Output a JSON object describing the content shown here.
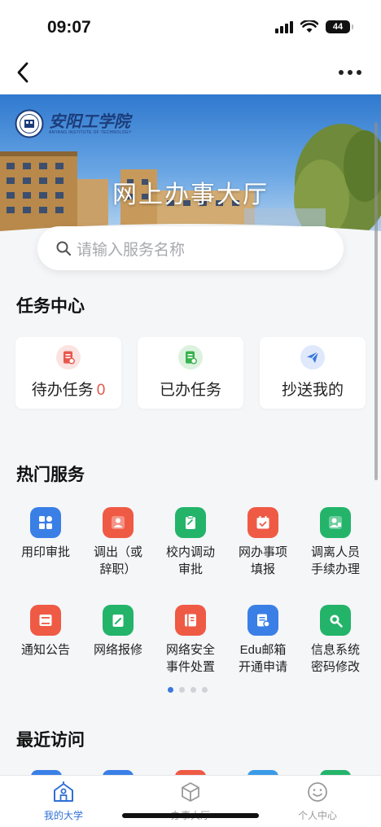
{
  "status_bar": {
    "time": "09:07",
    "battery": "44"
  },
  "banner": {
    "title": "网上办事大厅",
    "logo_cn": "安阳工学院",
    "logo_en": "ANYANG INSTITUTE OF TECHNOLOGY"
  },
  "search": {
    "placeholder": "请输入服务名称"
  },
  "task_center": {
    "title": "任务中心",
    "cards": [
      {
        "label": "待办任务",
        "count": "0",
        "icon": "doc-icon",
        "color": "#e8584f"
      },
      {
        "label": "已办任务",
        "icon": "doc-check-icon",
        "color": "#37b24d"
      },
      {
        "label": "抄送我的",
        "icon": "paper-plane-icon",
        "color": "#3b78dd"
      }
    ]
  },
  "hot_services": {
    "title": "热门服务",
    "items": [
      {
        "label": "用印审批",
        "icon": "grid-icon",
        "color": "#3a7fe6"
      },
      {
        "label": "调出（或\n辞职）",
        "icon": "person-icon",
        "color": "#ef5a45"
      },
      {
        "label": "校内调动\n审批",
        "icon": "clipboard-icon",
        "color": "#23b46a"
      },
      {
        "label": "网办事项\n填报",
        "icon": "calendar-icon",
        "color": "#ef5a45"
      },
      {
        "label": "调离人员\n手续办理",
        "icon": "person-badge-icon",
        "color": "#23b46a"
      },
      {
        "label": "通知公告",
        "icon": "notice-icon",
        "color": "#ef5a45"
      },
      {
        "label": "网络报修",
        "icon": "edit-icon",
        "color": "#23b46a"
      },
      {
        "label": "网络安全\n事件处置",
        "icon": "book-icon",
        "color": "#ef5a45"
      },
      {
        "label": "Edu邮箱\n开通申请",
        "icon": "mail-icon",
        "color": "#3a7fe6"
      },
      {
        "label": "信息系统\n密码修改",
        "icon": "search-doc-icon",
        "color": "#23b46a"
      }
    ],
    "page_count": 4,
    "active_page": 1
  },
  "recent": {
    "title": "最近访问"
  },
  "tab_bar": {
    "tabs": [
      {
        "label": "我的大学",
        "icon": "university-icon"
      },
      {
        "label": "办事大厅",
        "icon": "cube-icon"
      },
      {
        "label": "个人中心",
        "icon": "smile-icon"
      }
    ],
    "active": 0,
    "accent": "#2f6fd6"
  }
}
